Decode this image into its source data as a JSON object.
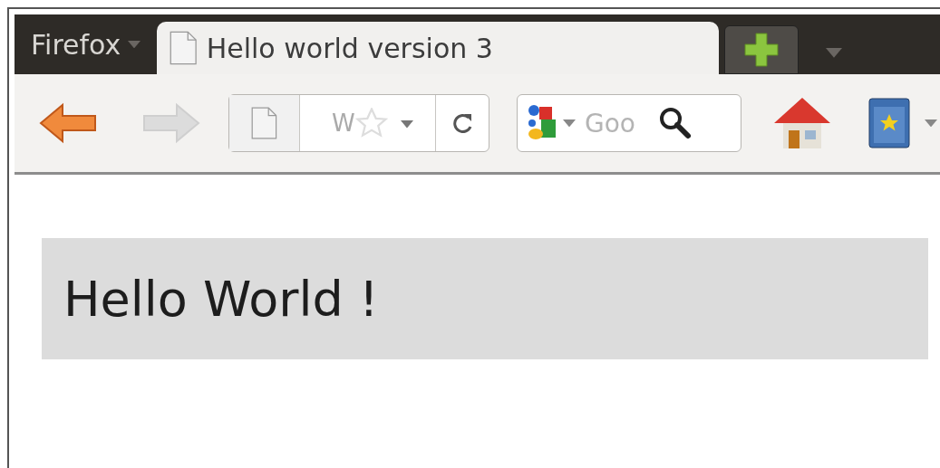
{
  "app_menu": {
    "label": "Firefox"
  },
  "tabs": [
    {
      "title": "Hello world version 3",
      "selected": true
    }
  ],
  "toolbar": {
    "back_enabled": true,
    "forward_enabled": false,
    "url": {
      "value": "W"
    },
    "search": {
      "value": "Goo"
    }
  },
  "content": {
    "heading": "Hello World !"
  }
}
